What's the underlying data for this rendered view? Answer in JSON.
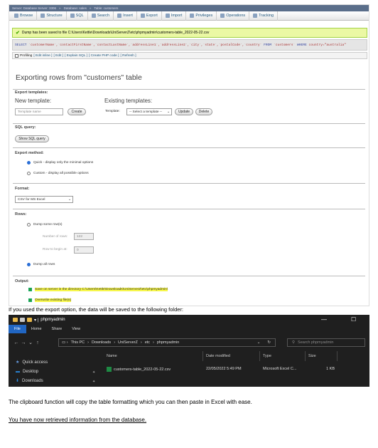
{
  "pma": {
    "breadcrumb": [
      "Server: Database Server: 3306",
      "Database: sales",
      "Table: customers"
    ],
    "tabs": [
      {
        "label": "Browse",
        "icon": "browse-icon"
      },
      {
        "label": "Structure",
        "icon": "structure-icon"
      },
      {
        "label": "SQL",
        "icon": "sql-icon"
      },
      {
        "label": "Search",
        "icon": "search-icon"
      },
      {
        "label": "Insert",
        "icon": "insert-icon"
      },
      {
        "label": "Export",
        "icon": "export-icon"
      },
      {
        "label": "Import",
        "icon": "import-icon"
      },
      {
        "label": "Privileges",
        "icon": "privileges-icon"
      },
      {
        "label": "Operations",
        "icon": "operations-icon"
      },
      {
        "label": "Tracking",
        "icon": "tracking-icon"
      }
    ],
    "success_message": "Dump has been saved to file C:\\Users\\Kettle\\Downloads\\UniServerZ\\etc\\phpmyadmin\\customers-table_2022-05-22.csv",
    "sql_keyword": "SELECT",
    "sql_columns": "`customerName`,`contactFirstName`,`contactLastName`,`addressLine1`,`addressLine2`,`city`,`state`,`postalCode`,`country`",
    "sql_from": "FROM",
    "sql_table": "`customers`",
    "sql_where": "WHERE",
    "sql_condition": "country=\"australia\"",
    "sql_tools": {
      "profiling": "Profiling",
      "edit_inline": "[ Edit inline ]",
      "edit": "[ Edit ]",
      "explain": "[ Explain SQL ]",
      "php": "[ Create PHP code ]",
      "refresh": "[ Refresh ]"
    },
    "page_title": "Exporting rows from \"customers\" table",
    "export_templates_label": "Export templates:",
    "new_template_label": "New template:",
    "existing_templates_label": "Existing templates:",
    "template_name_placeholder": "Template name",
    "create_button": "Create",
    "template_label": "Template:",
    "template_select": "-- Select a template --",
    "update_button": "Update",
    "delete_button": "Delete",
    "sql_query_label": "SQL query:",
    "show_sql_button": "Show SQL query",
    "export_method_label": "Export method:",
    "method_quick": "Quick - display only the minimal options",
    "method_custom": "Custom - display all possible options",
    "format_label": "Format:",
    "format_value": "CSV for MS Excel",
    "rows_label": "Rows:",
    "dump_some_rows": "Dump some row(s)",
    "number_of_rows_label": "Number of rows:",
    "number_of_rows_value": "122",
    "row_to_begin_label": "Row to begin at:",
    "row_to_begin_value": "0",
    "dump_all_rows": "Dump all rows",
    "output_label": "Output:",
    "save_on_server": "Save on server in the directory C:\\Users\\Kettle\\Downloads\\UniServerZ\\etc\\phpmyadmin\\",
    "overwrite_existing": "Overwrite existing file(s)"
  },
  "caption1": "If you used the export option, the data will be saved to the following folder:",
  "explorer": {
    "window_title": "phpmyadmin",
    "ribbon": [
      "File",
      "Home",
      "Share",
      "View"
    ],
    "path": [
      "This PC",
      "Downloads",
      "UniServerZ",
      "etc",
      "phpmyadmin"
    ],
    "search_placeholder": "Search phpmyadmin",
    "sidebar": [
      {
        "label": "Quick access",
        "icon": "star-icon"
      },
      {
        "label": "Desktop",
        "icon": "desktop-icon"
      },
      {
        "label": "Downloads",
        "icon": "download-icon"
      }
    ],
    "columns": [
      "Name",
      "Date modified",
      "Type",
      "Size"
    ],
    "file": {
      "name": "customers-table_2022-05-22.csv",
      "date": "22/05/2022 5:49 PM",
      "type": "Microsoft Excel C...",
      "size": "1 KB"
    },
    "controls": {
      "minimize": "—",
      "maximize": "☐"
    }
  },
  "caption2": "The clipboard function will copy the table formatting which you can then paste in Excel with ease.",
  "caption3": "You have now retrieved information from the database.",
  "colors": {
    "success_bg": "#ebf8a4",
    "highlight": "#f7f74a",
    "explorer_bg": "#1f1f1f",
    "file_tab": "#2166c2"
  }
}
